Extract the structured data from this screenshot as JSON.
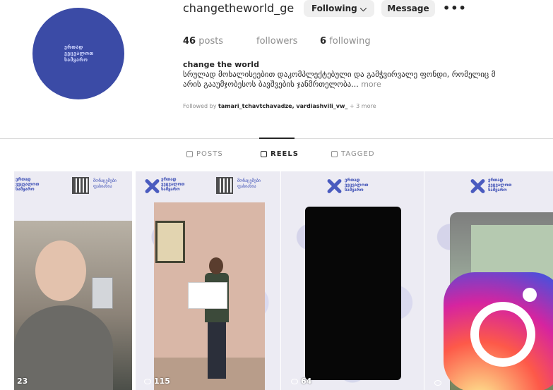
{
  "profile": {
    "username": "changetheworld_ge",
    "following_button": "Following ⌵",
    "message_button": "Message",
    "more": "•••",
    "avatar_text": "ერთად ვეცვალოთ სამყარო",
    "stats": {
      "posts_count": "46",
      "posts_label": "posts",
      "followers_label": "followers",
      "following_count": "6",
      "following_label": "following"
    },
    "full_name": "change the world",
    "bio_line1": "სრულად მოხალისეებით დაკომპლექტებული და გამჭვირვალე ფონდი, რომელიც მ",
    "bio_line2": "არის გააუმჯობესოს ბავშვების ჯანმრთელობა...",
    "bio_more": "more",
    "followed_by_prefix": "Followed by",
    "followed_by_names": "tamari_tchavtchavadze, vardiashvili_vw_",
    "followed_by_more": "+ 3 more"
  },
  "tabs": [
    {
      "label": "POSTS",
      "icon": "grid-icon",
      "active": false
    },
    {
      "label": "REELS",
      "icon": "reels-icon",
      "active": true
    },
    {
      "label": "TAGGED",
      "icon": "tagged-icon",
      "active": false
    }
  ],
  "reels": [
    {
      "views": "23",
      "logo_text": "ერთად ვეცვალოთ სამყარო",
      "qr_text": "მონაცემები ფასიანია"
    },
    {
      "views": "115",
      "logo_text": "ერთად ვეცვალოთ სამყარო",
      "qr_text": "მონაცემები ფასიანია"
    },
    {
      "views": "64",
      "logo_text": "ერთად ვეცვალოთ სამყარო"
    },
    {
      "views": "",
      "logo_text": "ერთად ვეცვალოთ სამყარო"
    }
  ],
  "overlay": {
    "icon": "instagram-logo-icon"
  },
  "colors": {
    "avatar_bg": "#3b4ba6",
    "brand_blue": "#4a5bbf",
    "button_bg": "#efefef"
  }
}
